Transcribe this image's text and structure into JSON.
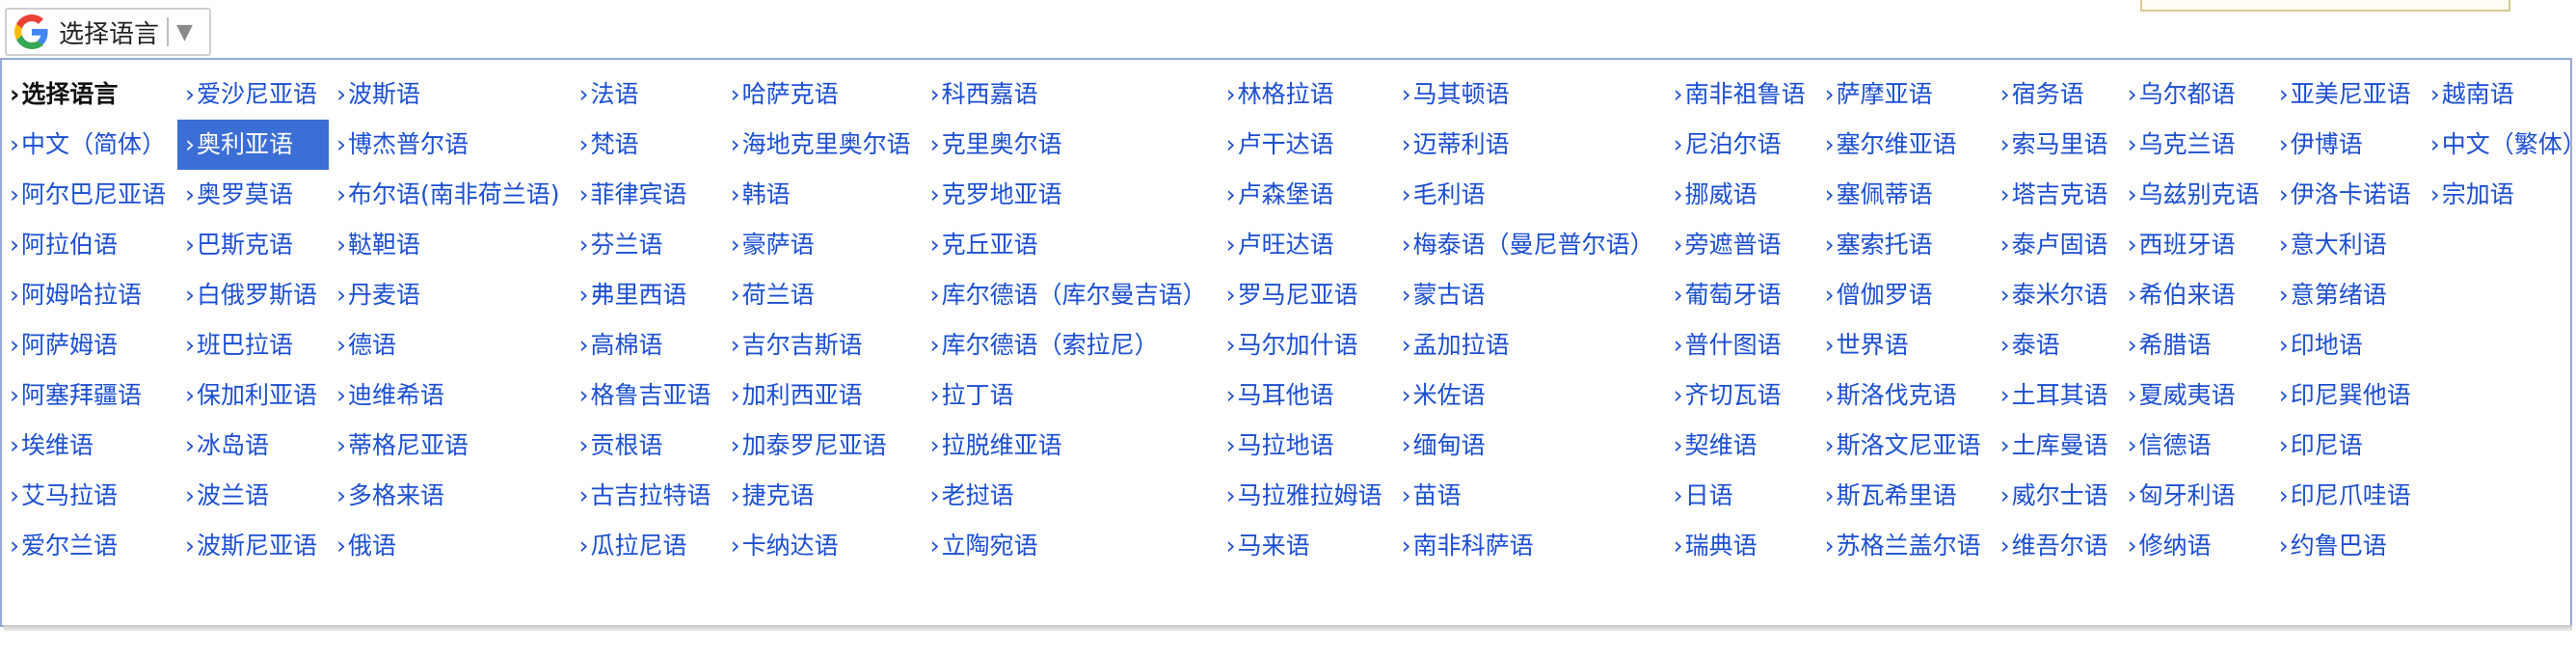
{
  "gadget": {
    "label": "选择语言",
    "arrow": "▼",
    "logo_colors": {
      "blue": "#4285F4",
      "red": "#EA4335",
      "yellow": "#FBBC05",
      "green": "#34A853"
    }
  },
  "menu": {
    "arrow": "›",
    "header_label": "选择语言",
    "selected_index": 10,
    "items": [
      "中文（简体）",
      "阿尔巴尼亚语",
      "阿拉伯语",
      "阿姆哈拉语",
      "阿萨姆语",
      "阿塞拜疆语",
      "埃维语",
      "艾马拉语",
      "爱尔兰语",
      "爱沙尼亚语",
      "奥利亚语",
      "奥罗莫语",
      "巴斯克语",
      "白俄罗斯语",
      "班巴拉语",
      "保加利亚语",
      "冰岛语",
      "波兰语",
      "波斯尼亚语",
      "波斯语",
      "博杰普尔语",
      "布尔语(南非荷兰语)",
      "鞑靼语",
      "丹麦语",
      "德语",
      "迪维希语",
      "蒂格尼亚语",
      "多格来语",
      "俄语",
      "法语",
      "梵语",
      "菲律宾语",
      "芬兰语",
      "弗里西语",
      "高棉语",
      "格鲁吉亚语",
      "贡根语",
      "古吉拉特语",
      "瓜拉尼语",
      "哈萨克语",
      "海地克里奥尔语",
      "韩语",
      "豪萨语",
      "荷兰语",
      "吉尔吉斯语",
      "加利西亚语",
      "加泰罗尼亚语",
      "捷克语",
      "卡纳达语",
      "科西嘉语",
      "克里奥尔语",
      "克罗地亚语",
      "克丘亚语",
      "库尔德语（库尔曼吉语）",
      "库尔德语（索拉尼）",
      "拉丁语",
      "拉脱维亚语",
      "老挝语",
      "立陶宛语",
      "林格拉语",
      "卢干达语",
      "卢森堡语",
      "卢旺达语",
      "罗马尼亚语",
      "马尔加什语",
      "马耳他语",
      "马拉地语",
      "马拉雅拉姆语",
      "马来语",
      "马其顿语",
      "迈蒂利语",
      "毛利语",
      "梅泰语（曼尼普尔语）",
      "蒙古语",
      "孟加拉语",
      "米佐语",
      "缅甸语",
      "苗语",
      "南非科萨语",
      "南非祖鲁语",
      "尼泊尔语",
      "挪威语",
      "旁遮普语",
      "葡萄牙语",
      "普什图语",
      "齐切瓦语",
      "契维语",
      "日语",
      "瑞典语",
      "萨摩亚语",
      "塞尔维亚语",
      "塞佩蒂语",
      "塞索托语",
      "僧伽罗语",
      "世界语",
      "斯洛伐克语",
      "斯洛文尼亚语",
      "斯瓦希里语",
      "苏格兰盖尔语",
      "宿务语",
      "索马里语",
      "塔吉克语",
      "泰卢固语",
      "泰米尔语",
      "泰语",
      "土耳其语",
      "土库曼语",
      "威尔士语",
      "维吾尔语",
      "乌尔都语",
      "乌克兰语",
      "乌兹别克语",
      "西班牙语",
      "希伯来语",
      "希腊语",
      "夏威夷语",
      "信德语",
      "匈牙利语",
      "修纳语",
      "亚美尼亚语",
      "伊博语",
      "伊洛卡诺语",
      "意大利语",
      "意第绪语",
      "印地语",
      "印尼巽他语",
      "印尼语",
      "印尼爪哇语",
      "约鲁巴语",
      "越南语",
      "中文（繁体）",
      "宗加语"
    ]
  }
}
